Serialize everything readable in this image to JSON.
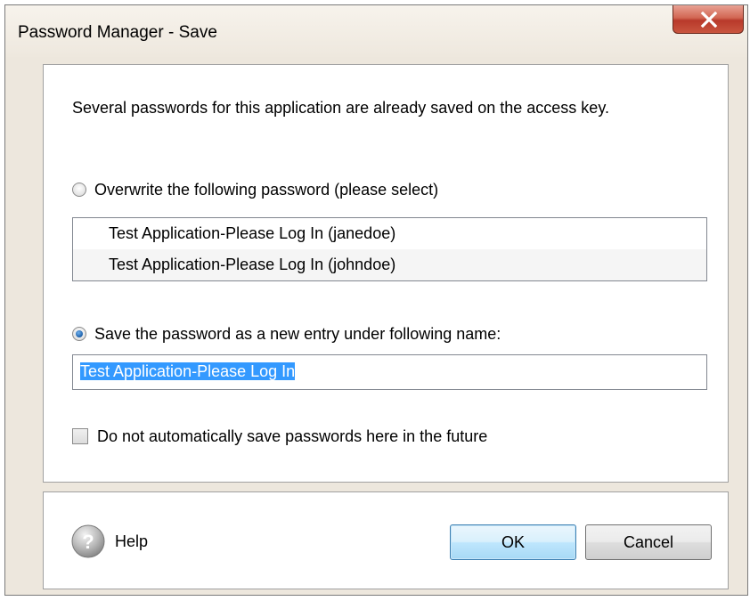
{
  "window": {
    "title": "Password Manager - Save"
  },
  "intro_text": "Several passwords for this application are already saved on the access key.",
  "overwrite_option": {
    "label": "Overwrite the following password (please select)",
    "checked": false
  },
  "password_list": [
    {
      "label": "Test Application-Please Log In (janedoe)"
    },
    {
      "label": "Test Application-Please Log In (johndoe)"
    }
  ],
  "new_entry_option": {
    "label": "Save the password as a new entry under following name:",
    "checked": true
  },
  "entry_name_input": {
    "value": "Test Application-Please Log In"
  },
  "no_autosave_checkbox": {
    "label": "Do not automatically save passwords here in the future",
    "checked": false
  },
  "footer": {
    "help_label": "Help",
    "ok_label": "OK",
    "cancel_label": "Cancel"
  },
  "icons": {
    "close": "close-icon",
    "help": "question-mark-icon"
  },
  "colors": {
    "window_background": "#ede7dd",
    "selection_highlight": "#3399ff",
    "close_button": "#c9553f",
    "default_button": "#bee6fd"
  }
}
